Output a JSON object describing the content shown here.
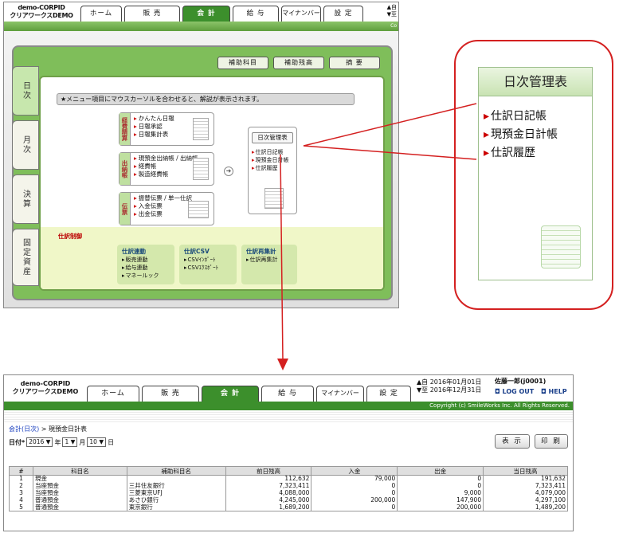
{
  "top": {
    "brand": "demo-CORPID\nクリアワークスDEMO",
    "tabs": [
      "ホーム",
      "販 売",
      "会 計",
      "給 与",
      "マイナンバー",
      "設 定"
    ],
    "date_mini": "▲自\n▼至",
    "copyright_mini": "Co",
    "side_tabs": [
      "日次",
      "月次",
      "決算",
      "固定資産"
    ],
    "top_buttons": [
      "補助科目",
      "補助残高",
      "摘 要"
    ],
    "notice": "★メニュー項目にマウスカーソルを合わせると、解説が表示されます。",
    "menus": [
      {
        "label": "経費精算",
        "items": [
          "かんたん日報",
          "日報承認",
          "日報集計表"
        ]
      },
      {
        "label": "出納帳",
        "items": [
          "現預金出納帳 / 出納帳",
          "経費帳",
          "製造経費帳"
        ]
      },
      {
        "label": "伝票",
        "items": [
          "振替伝票 / 単一仕訳",
          "入金伝票",
          "出金伝票"
        ]
      }
    ],
    "nikkei": {
      "title": "日次管理表",
      "items": [
        "仕訳日記帳",
        "現預金日計帳",
        "仕訳履歴"
      ]
    },
    "journal": {
      "title": "仕訳制御",
      "boxes": [
        {
          "title": "仕訳連動",
          "items": [
            "販売連動",
            "給与連動",
            "マネールック"
          ]
        },
        {
          "title": "仕訳CSV",
          "items": [
            "CSVｲﾝﾎﾟｰﾄ",
            "CSVｴｸｽﾎﾟｰﾄ"
          ]
        },
        {
          "title": "仕訳再集計",
          "items": [
            "仕訳再集計"
          ]
        }
      ]
    }
  },
  "callout": {
    "title": "日次管理表",
    "items": [
      "仕訳日記帳",
      "現預金日計帳",
      "仕訳履歴"
    ]
  },
  "bottom": {
    "brand": "demo-CORPID\nクリアワークスDEMO",
    "tabs": [
      "ホーム",
      "販 売",
      "会 計",
      "給 与",
      "マイナンバー",
      "設 定"
    ],
    "date_from": "▲自 2016年01月01日",
    "date_to": "▼至 2016年12月31日",
    "user": "佐藤一郎(j0001)",
    "logout": "◘ LOG OUT",
    "help": "◘ HELP",
    "copyright": "Copyright (c) SmileWorks Inc. All Rights Reserved.",
    "crumb_link": "会計(日次)",
    "crumb_rest": " > 現預金日計表",
    "date_label": "日付*",
    "year": "2016",
    "year_suffix": "年",
    "month": "1",
    "month_suffix": "月",
    "day": "10",
    "day_suffix": "日",
    "show_button": "表 示",
    "print_button": "印 刷",
    "columns": [
      "#",
      "科目名",
      "補助科目名",
      "前日残高",
      "入金",
      "出金",
      "当日残高"
    ],
    "rows": [
      [
        "1",
        "現金",
        "",
        "112,632",
        "79,000",
        "0",
        "191,632"
      ],
      [
        "2",
        "当座預金",
        "三井住友銀行",
        "7,323,411",
        "0",
        "0",
        "7,323,411"
      ],
      [
        "3",
        "当座預金",
        "三菱東京UFJ",
        "4,088,000",
        "0",
        "9,000",
        "4,079,000"
      ],
      [
        "4",
        "普通預金",
        "あさひ銀行",
        "4,245,000",
        "200,000",
        "147,900",
        "4,297,100"
      ],
      [
        "5",
        "普通預金",
        "東京銀行",
        "1,689,200",
        "0",
        "200,000",
        "1,489,200"
      ]
    ]
  },
  "colors": {
    "accent": "#3c8f2c",
    "callout_border": "#d42020",
    "link": "#1a3fbf"
  }
}
